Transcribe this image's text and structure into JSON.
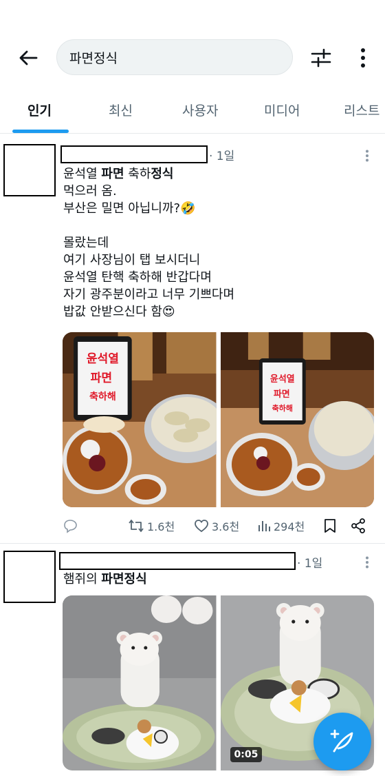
{
  "search": {
    "query": "파면정식"
  },
  "tabs": [
    {
      "label": "인기",
      "active": true
    },
    {
      "label": "최신"
    },
    {
      "label": "사용자"
    },
    {
      "label": "미디어"
    },
    {
      "label": "리스트"
    }
  ],
  "posts": [
    {
      "time": "· 1일",
      "text_lines": [
        [
          "윤석열 ",
          "파면",
          " 축하",
          "정식",
          ""
        ],
        "먹으러 옴.",
        "부산은 밀면 아닙니까?🤣",
        "",
        "몰랐는데",
        "여기 사장님이 탭 보시더니",
        "윤석열 탄핵 축하해 반갑다며",
        "자기 광주분이라고 너무 기쁘다며",
        "밥값 안받으신다 함😍"
      ],
      "tablet_sign": [
        "윤석열",
        "파면",
        "축하해"
      ],
      "stats": {
        "retweets": "1.6천",
        "likes": "3.6천",
        "views": "294천"
      }
    },
    {
      "time": "· 1일",
      "text_parts": [
        "햄쥐의 ",
        "파면정식"
      ],
      "video_duration": "0:05"
    }
  ],
  "colors": {
    "accent": "#1d9bf0",
    "text": "#0f1419",
    "muted": "#536471"
  }
}
